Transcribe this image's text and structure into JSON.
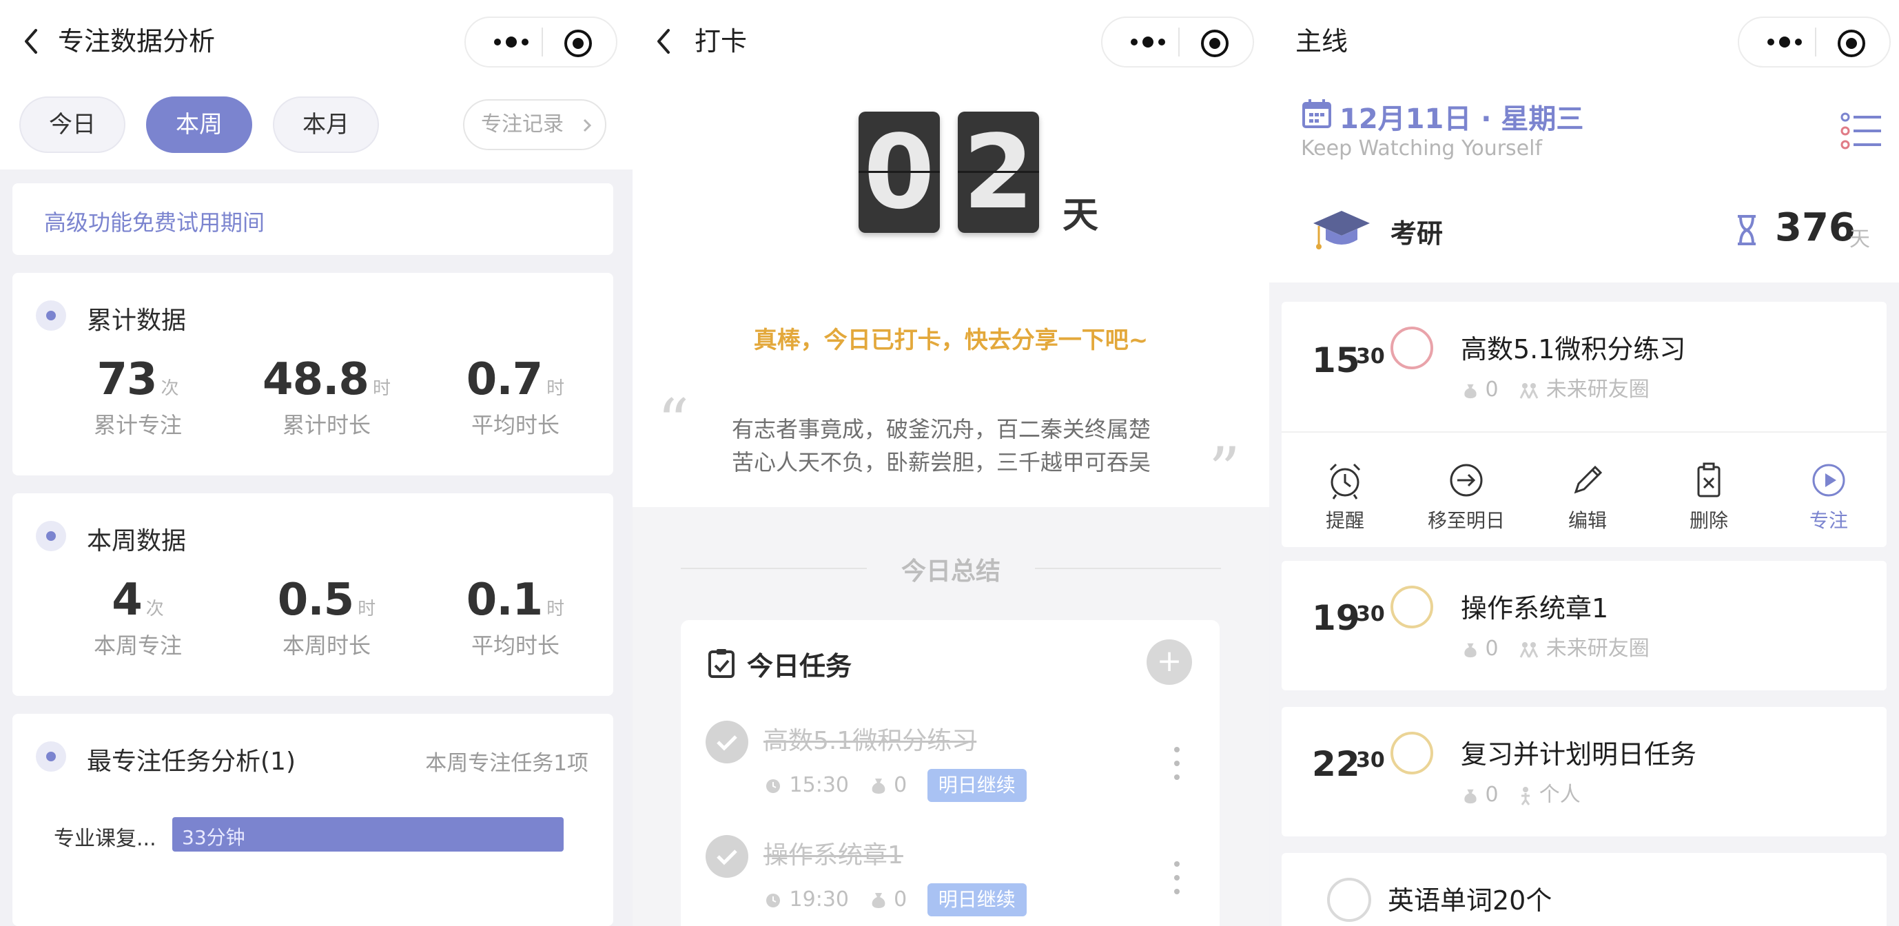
{
  "panel1": {
    "nav_title": "专注数据分析",
    "tabs": [
      "今日",
      "本周",
      "本月"
    ],
    "active_tab": 1,
    "record_label": "专注记录",
    "trial_notice": "高级功能免费试用期间",
    "cumulative": {
      "title": "累计数据",
      "stats": [
        {
          "value": "73",
          "unit": "次",
          "label": "累计专注"
        },
        {
          "value": "48.8",
          "unit": "时",
          "label": "累计时长"
        },
        {
          "value": "0.7",
          "unit": "时",
          "label": "平均时长"
        }
      ]
    },
    "week": {
      "title": "本周数据",
      "stats": [
        {
          "value": "4",
          "unit": "次",
          "label": "本周专注"
        },
        {
          "value": "0.5",
          "unit": "时",
          "label": "本周时长"
        },
        {
          "value": "0.1",
          "unit": "时",
          "label": "平均时长"
        }
      ]
    },
    "analysis": {
      "title": "最专注任务分析(1)",
      "note": "本周专注任务1项",
      "items": [
        {
          "label": "专业课复...",
          "value_text": "33分钟",
          "fraction": 1.0
        }
      ]
    },
    "accent": "#7b84cf"
  },
  "panel2": {
    "nav_title": "打卡",
    "digits": [
      "0",
      "2"
    ],
    "day_unit": "天",
    "praise": "真棒，今日已打卡，快去分享一下吧~",
    "quote_open": "“",
    "quote_close": "”",
    "quote_lines": [
      "有志者事竟成，破釜沉舟，百二秦关终属楚",
      "苦心人天不负，卧薪尝胆，三千越甲可吞吴"
    ],
    "summary_title": "今日总结",
    "tasks_title": "今日任务",
    "add_symbol": "+",
    "tasks": [
      {
        "name": "高数5.1微积分练习",
        "time": "15:30",
        "count": "0",
        "tag": "明日继续"
      },
      {
        "name": "操作系统章1",
        "time": "19:30",
        "count": "0",
        "tag": "明日继续"
      }
    ],
    "praise_color": "#e3a83b"
  },
  "panel3": {
    "nav_title": "主线",
    "date": "12月11日 · 星期三",
    "slogan": "Keep Watching Yourself",
    "goal": {
      "name": "考研",
      "days": "376",
      "unit": "天"
    },
    "plans": [
      {
        "hour": "15",
        "minute": "30",
        "title": "高数5.1微积分练习",
        "count": "0",
        "group": "未来研友圈",
        "ring": "red"
      },
      {
        "hour": "19",
        "minute": "30",
        "title": "操作系统章1",
        "count": "0",
        "group": "未来研友圈",
        "ring": "yellow"
      },
      {
        "hour": "22",
        "minute": "30",
        "title": "复习并计划明日任务",
        "count": "0",
        "group": "个人",
        "ring": "yellow"
      },
      {
        "title": "英语单词20个"
      }
    ],
    "actions": [
      "提醒",
      "移至明日",
      "编辑",
      "删除",
      "专注"
    ]
  }
}
